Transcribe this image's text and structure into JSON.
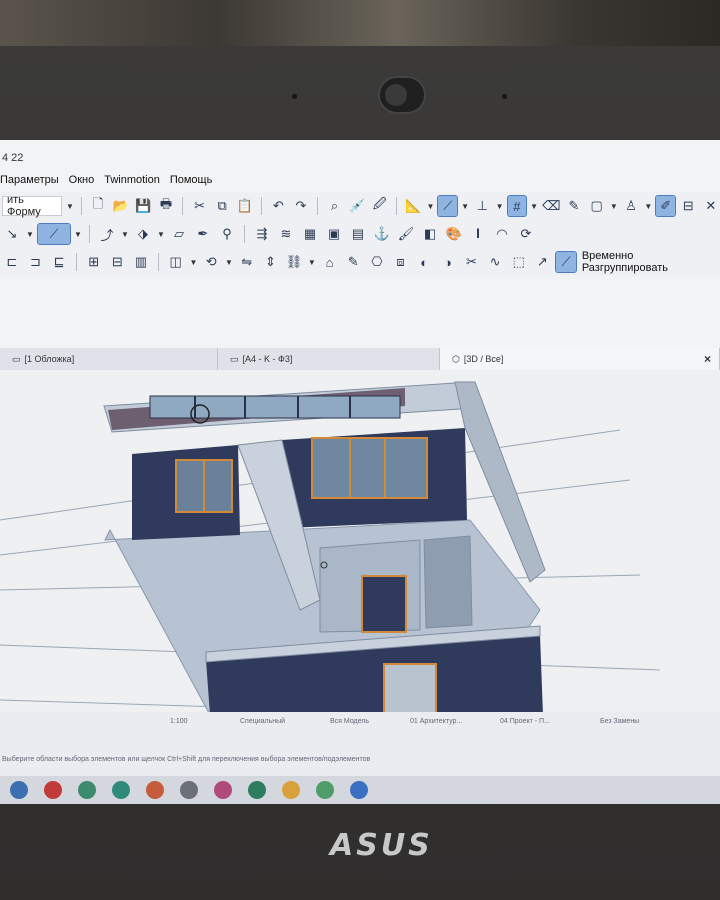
{
  "window": {
    "title_fragment": "4 22"
  },
  "menu": [
    "Параметры",
    "Окно",
    "Twinmotion",
    "Помощь"
  ],
  "toolbar1": {
    "form_combo": "ить Форму"
  },
  "toolbar3": {
    "ungroup_label": "Временно Разгруппировать"
  },
  "tabs": [
    {
      "label": "[1 Обложка]",
      "icon": "layout-icon"
    },
    {
      "label": "[A4 - K - Ф3]",
      "icon": "sheet-icon"
    },
    {
      "label": "[3D / Все]",
      "icon": "cube-icon",
      "active": true
    }
  ],
  "tab_close": "×",
  "status": {
    "scale": "1:100",
    "view_special": "Специальный",
    "model": "Вся Модель",
    "layer": "01 Архитектур...",
    "project": "04 Проект - П...",
    "zones": "Без Замены",
    "hint": "Выберите области выбора элементов или щелчок Ctrl+Shift для переключения выбора элементов/подэлементов"
  },
  "brand": {
    "laptop_logo": "ASUS"
  },
  "colors": {
    "accent_active": "#8fb4e2",
    "wall_face": "#2f3a5c",
    "floor": "#b7c3d2",
    "frame_orange": "#d18a3a"
  }
}
